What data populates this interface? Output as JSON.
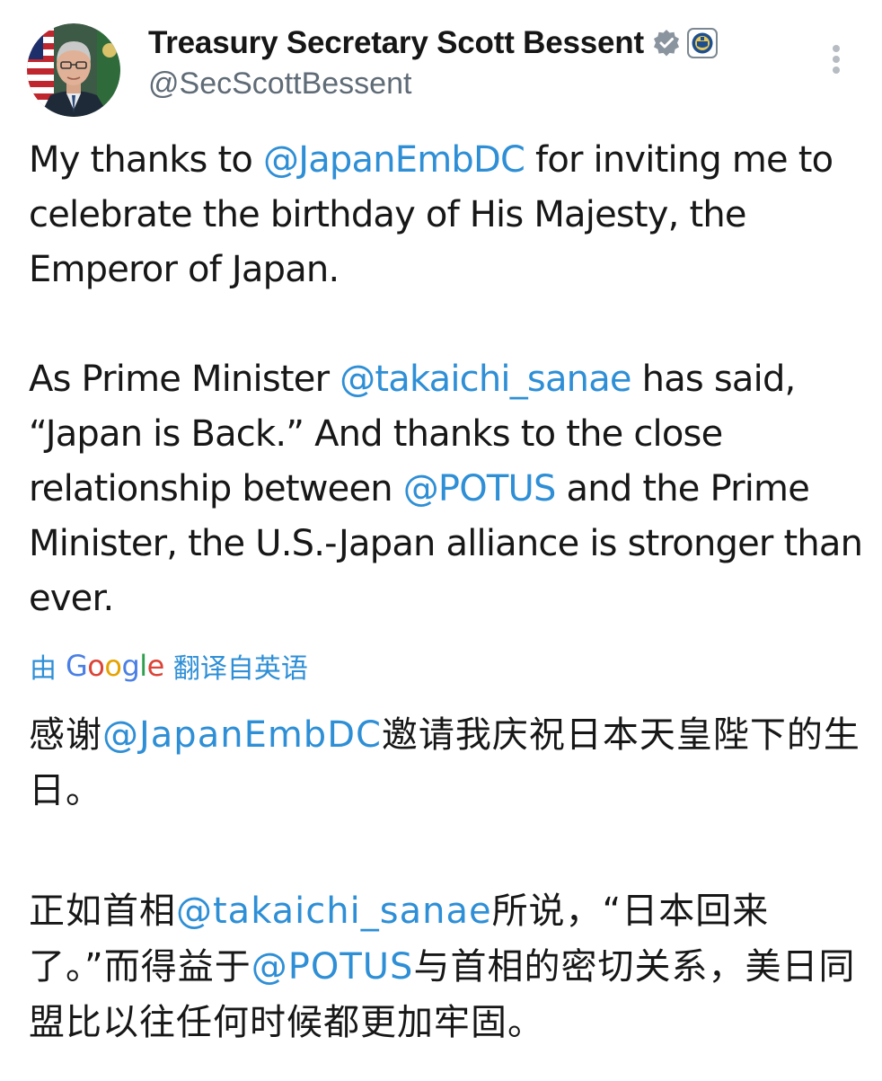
{
  "author": {
    "display_name": "Treasury Secretary Scott Bessent",
    "handle": "@SecScottBessent"
  },
  "icons": {
    "avatar": "profile-photo",
    "verified": "gray-verified-badge-icon",
    "affiliate": "treasury-seal-icon",
    "more": "vertical-more-icon"
  },
  "post": {
    "paragraph_1": {
      "t1": "My thanks to ",
      "m1": "@JapanEmbDC",
      "t2": " for inviting me to celebrate the birthday of His Majesty, the Emperor of Japan."
    },
    "paragraph_2": {
      "t1": "As Prime Minister ",
      "m1": "@takaichi_sanae",
      "t2": " has said, “Japan is Back.” And thanks to the close relationship between ",
      "m2": "@POTUS",
      "t3": " and the Prime Minister, the U.S.-Japan alliance is stronger than ever."
    }
  },
  "translation": {
    "prefix": "由",
    "provider_letters": [
      "G",
      "o",
      "o",
      "g",
      "l",
      "e"
    ],
    "suffix": "翻译自英语",
    "paragraph_1": {
      "t1": "感谢",
      "m1": "@JapanEmbDC",
      "t2": "邀请我庆祝日本天皇陛下的生日。"
    },
    "paragraph_2": {
      "t1": "正如首相",
      "m1": "@takaichi_sanae",
      "t2": "所说，“日本回来了。”而得益于",
      "m2": "@POTUS",
      "t3": "与首相的密切关系，美日同盟比以往任何时候都更加牢固。"
    }
  },
  "colors": {
    "link": "#2e8fd6",
    "text": "#171717",
    "handle": "#5f6b76",
    "verified": "#8a949e"
  }
}
